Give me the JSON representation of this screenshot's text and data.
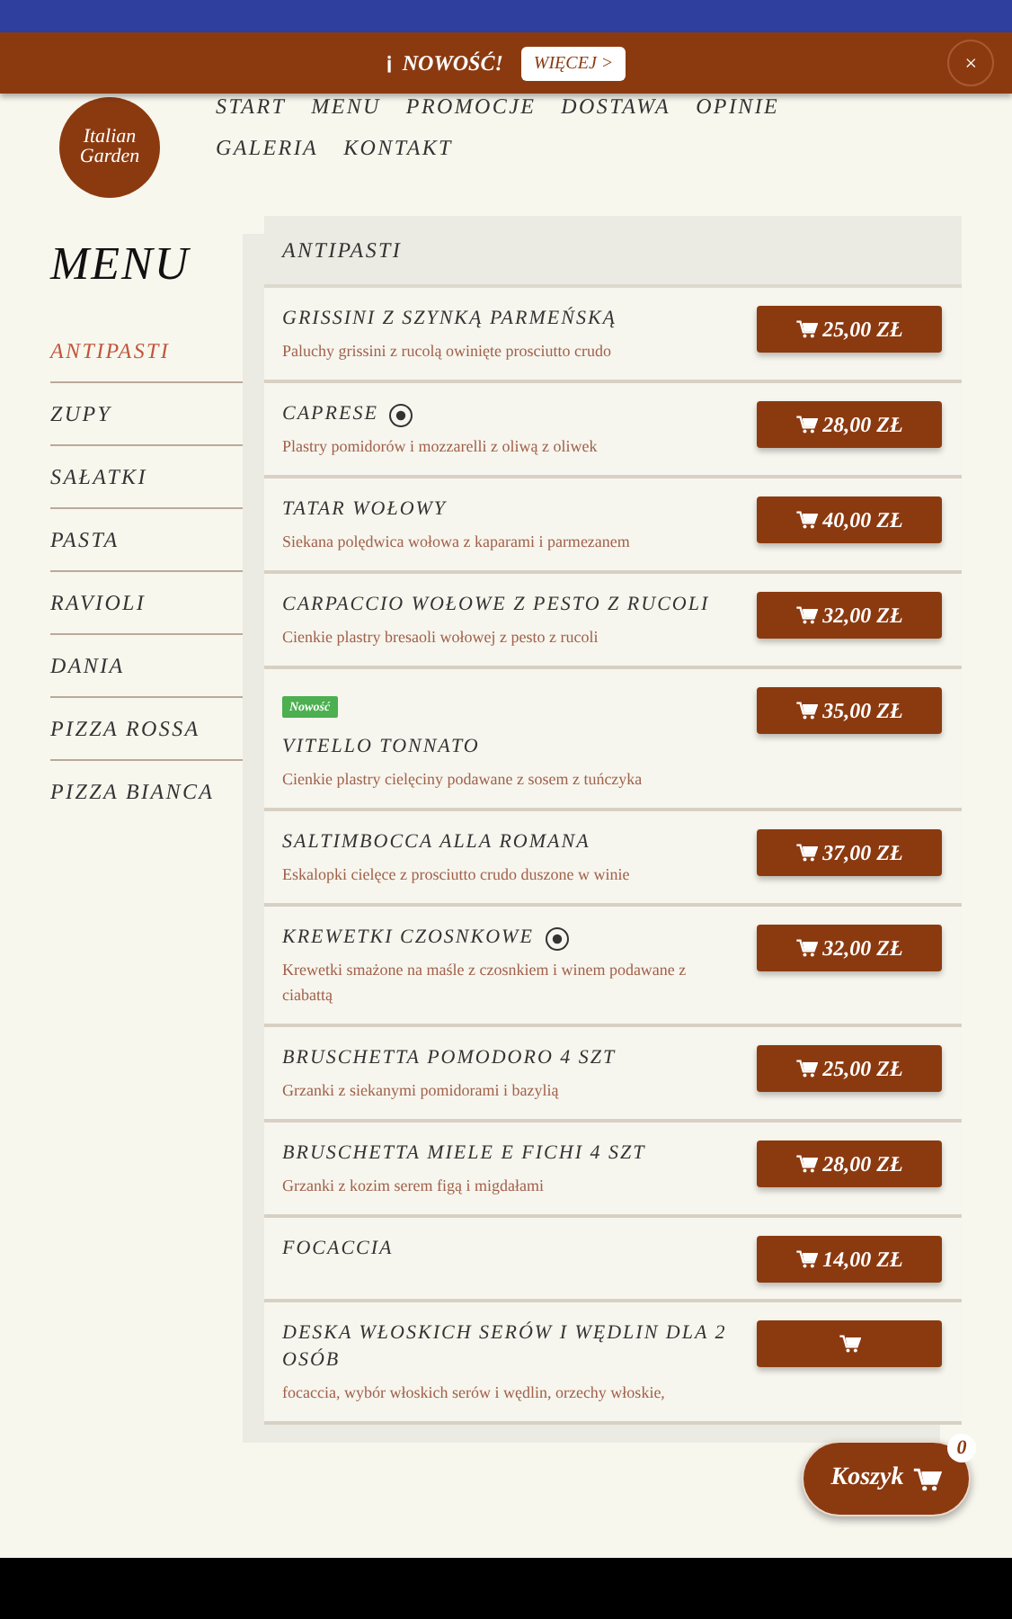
{
  "announcement": {
    "icon": "ℹ",
    "text": "NOWOŚĆ!",
    "button": "WIĘCEJ >",
    "close": "×"
  },
  "logo": {
    "line_1": "Italian",
    "line_2": "Garden"
  },
  "nav": [
    "START",
    "MENU",
    "PROMOCJE",
    "DOSTAWA",
    "OPINIE",
    "GALERIA",
    "KONTAKT"
  ],
  "sidebar": {
    "title": "MENU",
    "items": [
      {
        "label": "ANTIPASTI",
        "selected": true
      },
      {
        "label": "ZUPY",
        "selected": false
      },
      {
        "label": "SAŁATKI",
        "selected": false
      },
      {
        "label": "PASTA",
        "selected": false
      },
      {
        "label": "RAVIOLI",
        "selected": false
      },
      {
        "label": "DANIA",
        "selected": false
      },
      {
        "label": "PIZZA ROSSA",
        "selected": false
      },
      {
        "label": "PIZZA BIANCA",
        "selected": false
      }
    ]
  },
  "category": "ANTIPASTI",
  "items": [
    {
      "name": "GRISSINI Z SZYNKĄ PARMEŃSKĄ",
      "description": "Paluchy grissini z rucolą owinięte prosciutto crudo",
      "price": "25,00 ZŁ",
      "marked": false
    },
    {
      "name": "CAPRESE",
      "description": "Plastry pomidorów i mozzarelli z oliwą z oliwek",
      "price": "28,00 ZŁ",
      "marked": true
    },
    {
      "name": "TATAR WOŁOWY",
      "description": "Siekana polędwica wołowa z kaparami i parmezanem",
      "price": "40,00 ZŁ",
      "marked": false
    },
    {
      "name": "CARPACCIO WOŁOWE Z PESTO Z RUCOLI",
      "description": "Cienkie plastry bresaoli wołowej z pesto z rucoli",
      "price": "32,00 ZŁ",
      "marked": false
    },
    {
      "name": "VITELLO TONNATO",
      "badge": "Nowość",
      "description": "Cienkie plastry cielęciny podawane z sosem z tuńczyka",
      "price": "35,00 ZŁ",
      "marked": false
    },
    {
      "name": "SALTIMBOCCA ALLA ROMANA",
      "description": "Eskalopki cielęce z prosciutto crudo duszone w winie",
      "price": "37,00 ZŁ",
      "marked": false
    },
    {
      "name": "KREWETKI CZOSNKOWE",
      "description": "Krewetki smażone na maśle z czosnkiem i winem podawane z ciabattą",
      "price": "32,00 ZŁ",
      "marked": true
    },
    {
      "name": "BRUSCHETTA POMODORO 4 SZT",
      "description": "Grzanki z siekanymi pomidorami i bazylią",
      "price": "25,00 ZŁ",
      "marked": false
    },
    {
      "name": "BRUSCHETTA MIELE E FICHI 4 SZT",
      "description": "Grzanki z kozim serem figą i migdałami",
      "price": "28,00 ZŁ",
      "marked": false
    },
    {
      "name": "FOCACCIA",
      "price": "14,00 ZŁ",
      "marked": false
    },
    {
      "name": "DESKA WŁOSKICH SERÓW I WĘDLIN DLA 2 OSÓB",
      "description": "focaccia, wybór włoskich serów i wędlin, orzechy włoskie,",
      "marked": false
    }
  ],
  "cart": {
    "label": "Koszyk",
    "count": "0"
  }
}
